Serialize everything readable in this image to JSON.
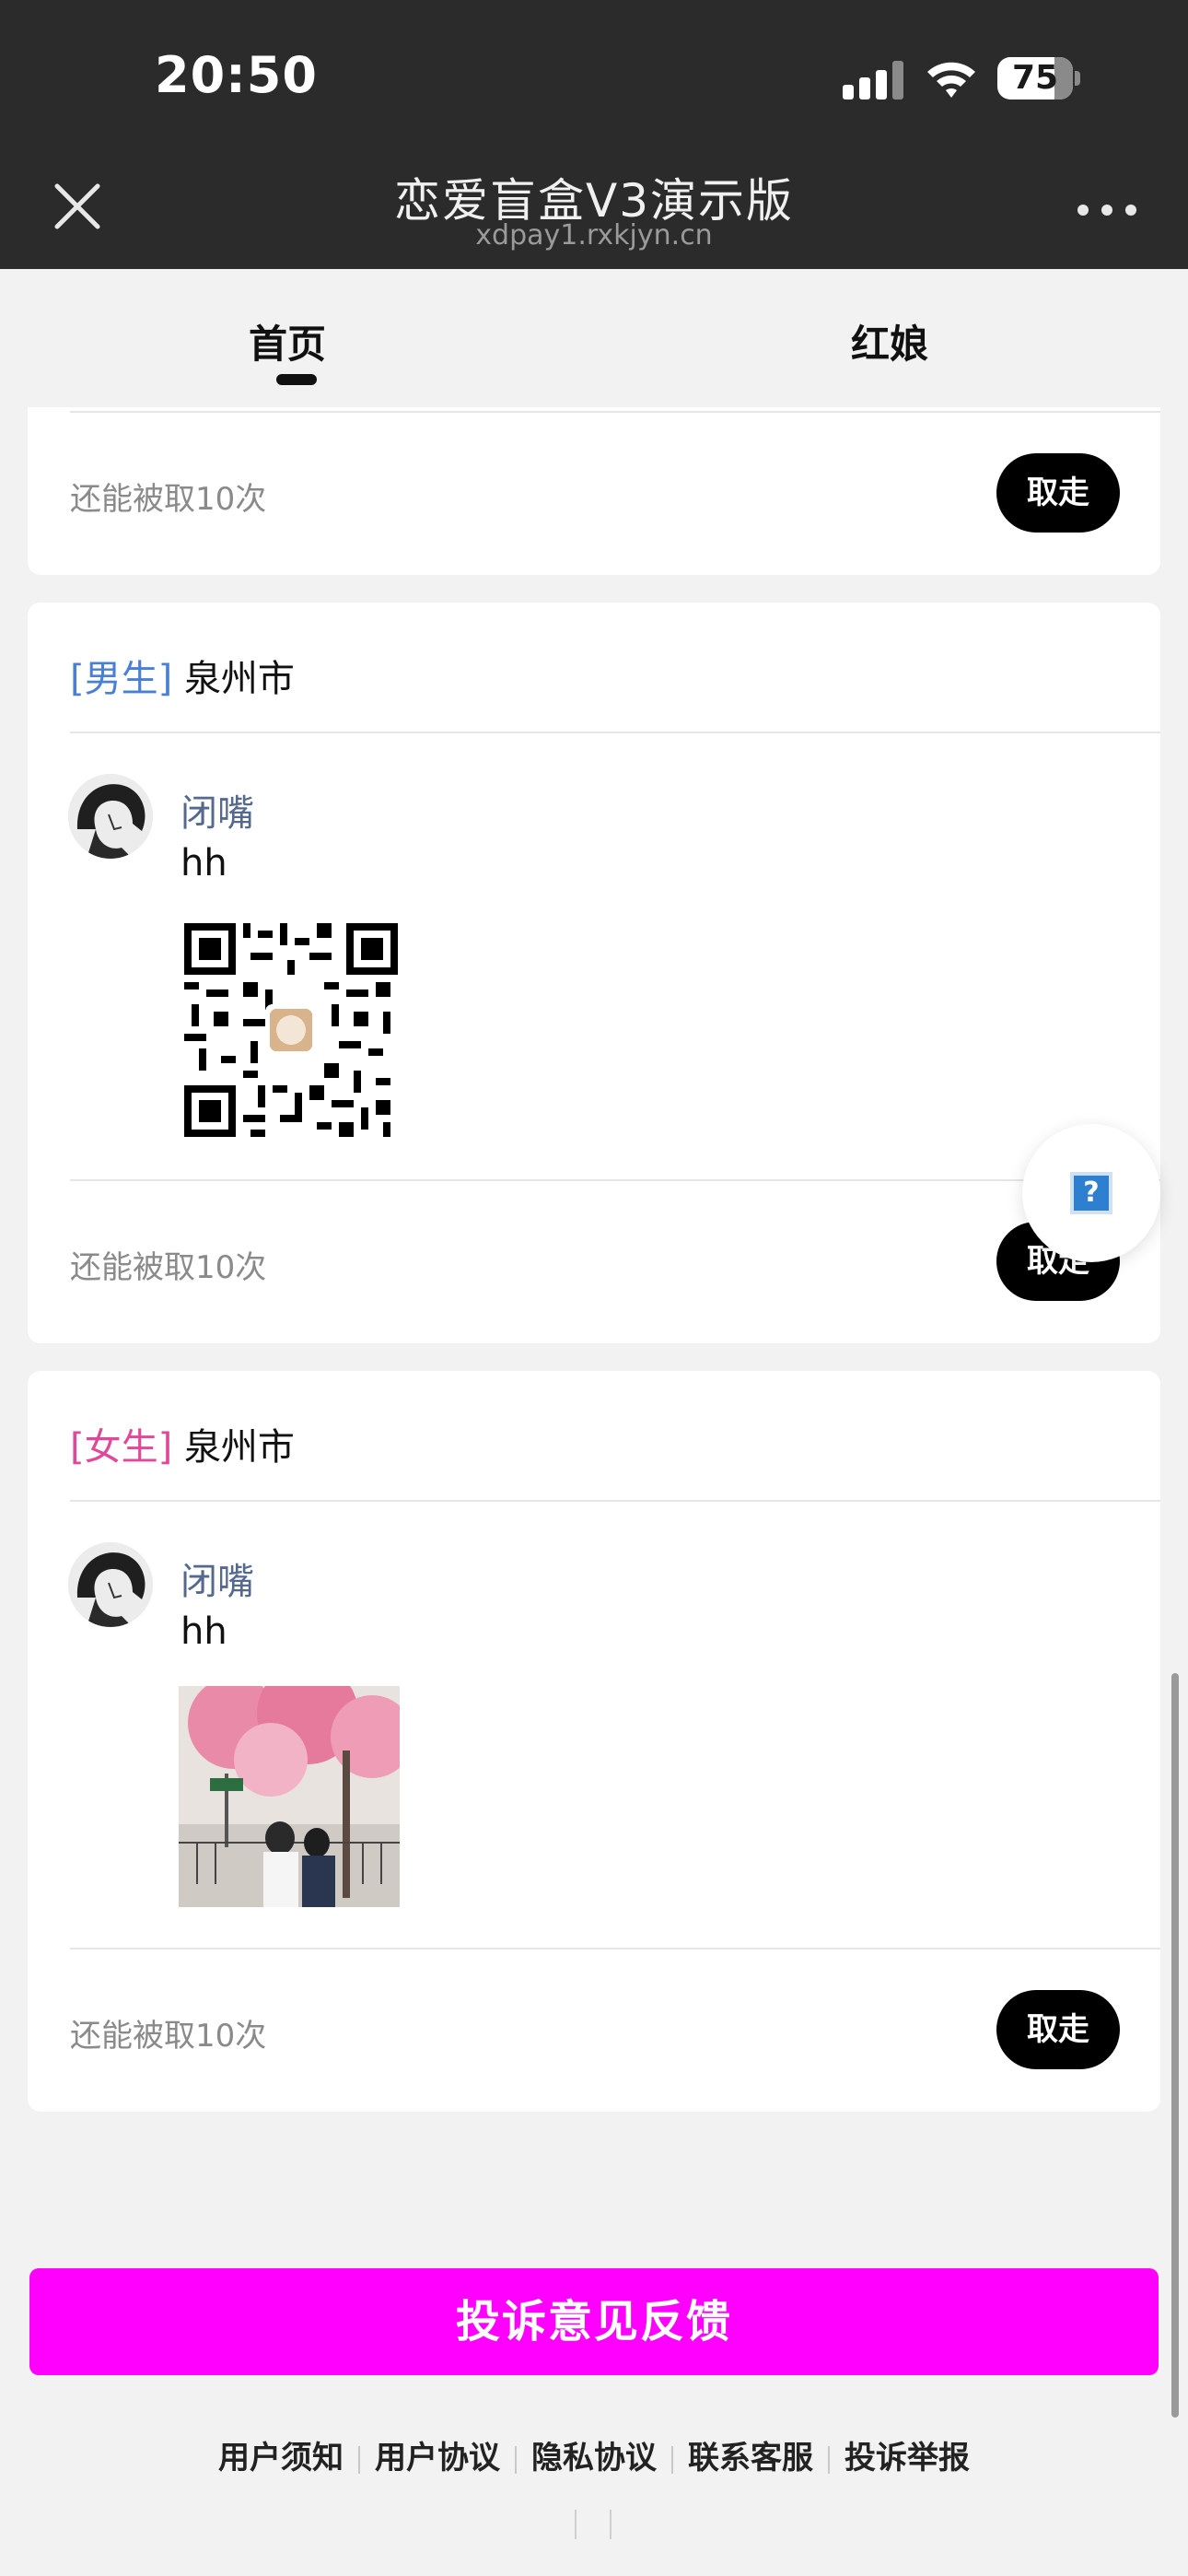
{
  "status_bar": {
    "time": "20:50",
    "battery": "75"
  },
  "title_bar": {
    "title": "恋爱盲盒V3演示版",
    "subtitle": "xdpay1.rxkjyn.cn"
  },
  "tabs": [
    {
      "label": "首页",
      "selected": true
    },
    {
      "label": "红娘",
      "selected": false
    }
  ],
  "cards": [
    {
      "remaining": "还能被取10次",
      "take_label": "取走"
    },
    {
      "gender": "[男生]",
      "city": "泉州市",
      "username": "闭嘴",
      "message": "hh",
      "attachment": "qr-code",
      "remaining": "还能被取10次",
      "take_label": "取走"
    },
    {
      "gender": "[女生]",
      "city": "泉州市",
      "username": "闭嘴",
      "message": "hh",
      "attachment": "photo",
      "remaining": "还能被取10次",
      "take_label": "取走"
    }
  ],
  "help_button": {
    "icon": "question-icon",
    "glyph": "?"
  },
  "feedback_button": {
    "label": "投诉意见反馈"
  },
  "footer_links": [
    "用户须知",
    "用户协议",
    "隐私协议",
    "联系客服",
    "投诉举报"
  ],
  "colors": {
    "accent": "#ff00ff",
    "male": "#4a7fd6",
    "female": "#e0489a",
    "username": "#55698f"
  }
}
